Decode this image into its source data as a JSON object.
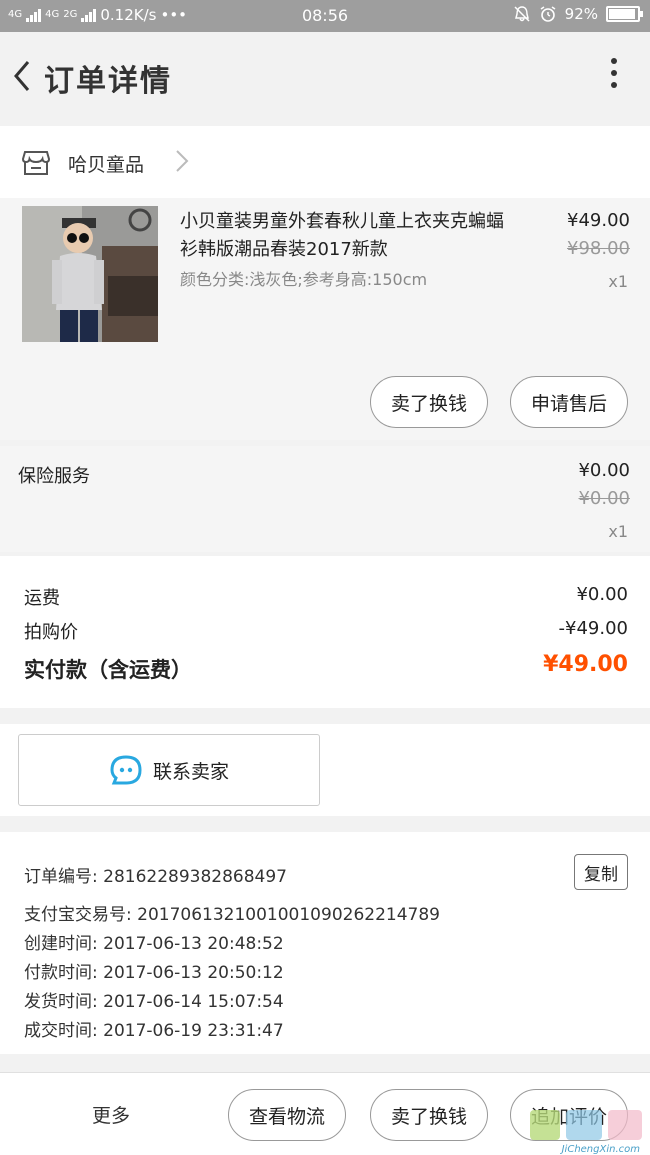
{
  "status_bar": {
    "network_label": "4G",
    "network_label_2": "4G",
    "network_label_3": "2G",
    "speed": "0.12K/s",
    "dots": "•••",
    "time": "08:56",
    "battery": "92%",
    "battery_level": 0.92
  },
  "header": {
    "title": "订单详情"
  },
  "shop": {
    "name": "哈贝童品"
  },
  "product": {
    "title": "小贝童装男童外套春秋儿童上衣夹克蝙蝠衫韩版潮品春装2017新款",
    "sku": "颜色分类:浅灰色;参考身高:150cm",
    "price": "¥49.00",
    "original_price": "¥98.00",
    "quantity": "x1",
    "actions": [
      "卖了换钱",
      "申请售后"
    ]
  },
  "insurance": {
    "label": "保险服务",
    "price": "¥0.00",
    "original_price": "¥0.00",
    "quantity": "x1"
  },
  "totals": {
    "shipping_label": "运费",
    "shipping_value": "¥0.00",
    "discount_label": "拍购价",
    "discount_value": "-¥49.00",
    "paid_label": "实付款（含运费）",
    "paid_value": "¥49.00"
  },
  "contact": {
    "label": "联系卖家"
  },
  "order_info": {
    "order_no": "订单编号: 2816228938286849​7",
    "alipay_no": "支付宝交易号: 2017061321001001090262214789",
    "created": "创建时间: 2017-06-13 20:48:52",
    "paid": "付款时间: 2017-06-13 20:50:12",
    "shipped": "发货时间: 2017-06-14 15:07:54",
    "completed": "成交时间: 2017-06-19 23:31:47",
    "copy_label": "复制"
  },
  "bottom_bar": {
    "more": "更多",
    "actions": [
      "查看物流",
      "卖了换钱",
      "追加评价"
    ]
  },
  "watermark": {
    "text": "JiChengXin.com"
  },
  "colors": {
    "accent": "#ff5000",
    "chat_icon": "#29a8e0",
    "status_bar": "#9e9e9e"
  }
}
